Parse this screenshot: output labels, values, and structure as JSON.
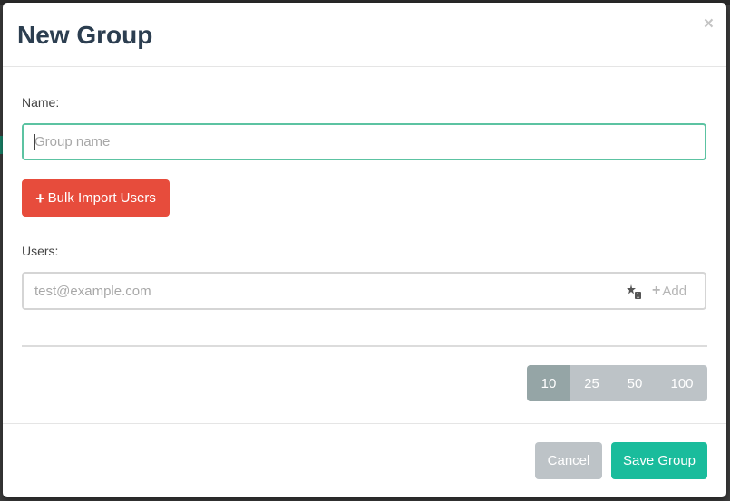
{
  "modal": {
    "title": "New Group",
    "close_label": "×"
  },
  "form": {
    "name_label": "Name:",
    "name_placeholder": "Group name",
    "name_value": "",
    "bulk_import_label": "Bulk Import Users",
    "users_label": "Users:",
    "users_placeholder": "test@example.com",
    "users_value": "",
    "add_label": "Add"
  },
  "pagination": {
    "sizes": [
      "10",
      "25",
      "50",
      "100"
    ],
    "selected": "10"
  },
  "footer": {
    "cancel_label": "Cancel",
    "save_label": "Save Group"
  },
  "icons": {
    "plus": "plus-icon",
    "user_add": "user-plus-icon",
    "close": "close-icon"
  },
  "colors": {
    "danger": "#e74c3c",
    "primary": "#1abc9c",
    "muted": "#bdc3c7",
    "muted_active": "#95a5a6",
    "focus_border": "#5cc3a2",
    "title": "#2c3e50"
  }
}
